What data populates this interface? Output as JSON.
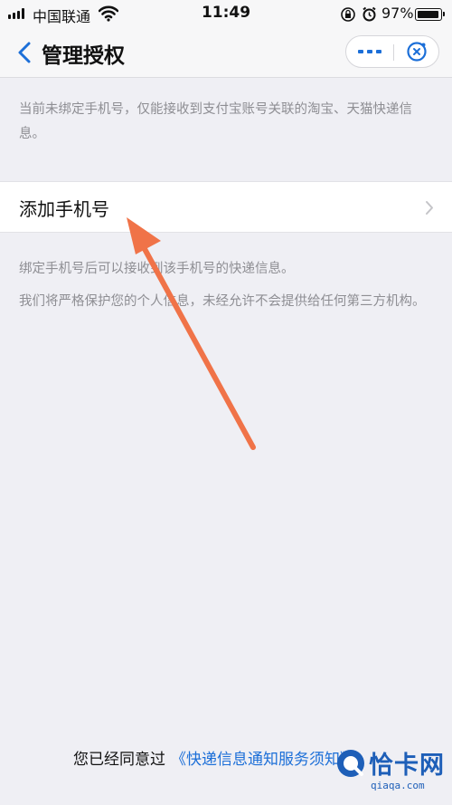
{
  "status_bar": {
    "carrier": "中国联通",
    "time": "11:49",
    "battery": "97%",
    "battery_level": 0.97
  },
  "nav": {
    "title": "管理授权",
    "back_icon": "chevron-left-icon",
    "more_icon": "more-dots-icon",
    "close_icon": "close-circle-icon"
  },
  "notice": "当前未绑定手机号，仅能接收到支付宝账号关联的淘宝、天猫快递信息。",
  "add_phone": {
    "label": "添加手机号",
    "chevron_icon": "chevron-right-icon"
  },
  "description": {
    "line1": "绑定手机号后可以接收到该手机号的快递信息。",
    "line2": "我们将严格保护您的个人信息，未经允许不会提供给任何第三方机构。"
  },
  "agreement": {
    "prefix": "您已经同意过",
    "link": "《快递信息通知服务须知》"
  },
  "watermark": {
    "title": "恰卡网",
    "subtitle": "qiaqa.com"
  },
  "colors": {
    "accent": "#1c6fd8",
    "annotation_arrow": "#f07348",
    "background": "#efeff4"
  }
}
